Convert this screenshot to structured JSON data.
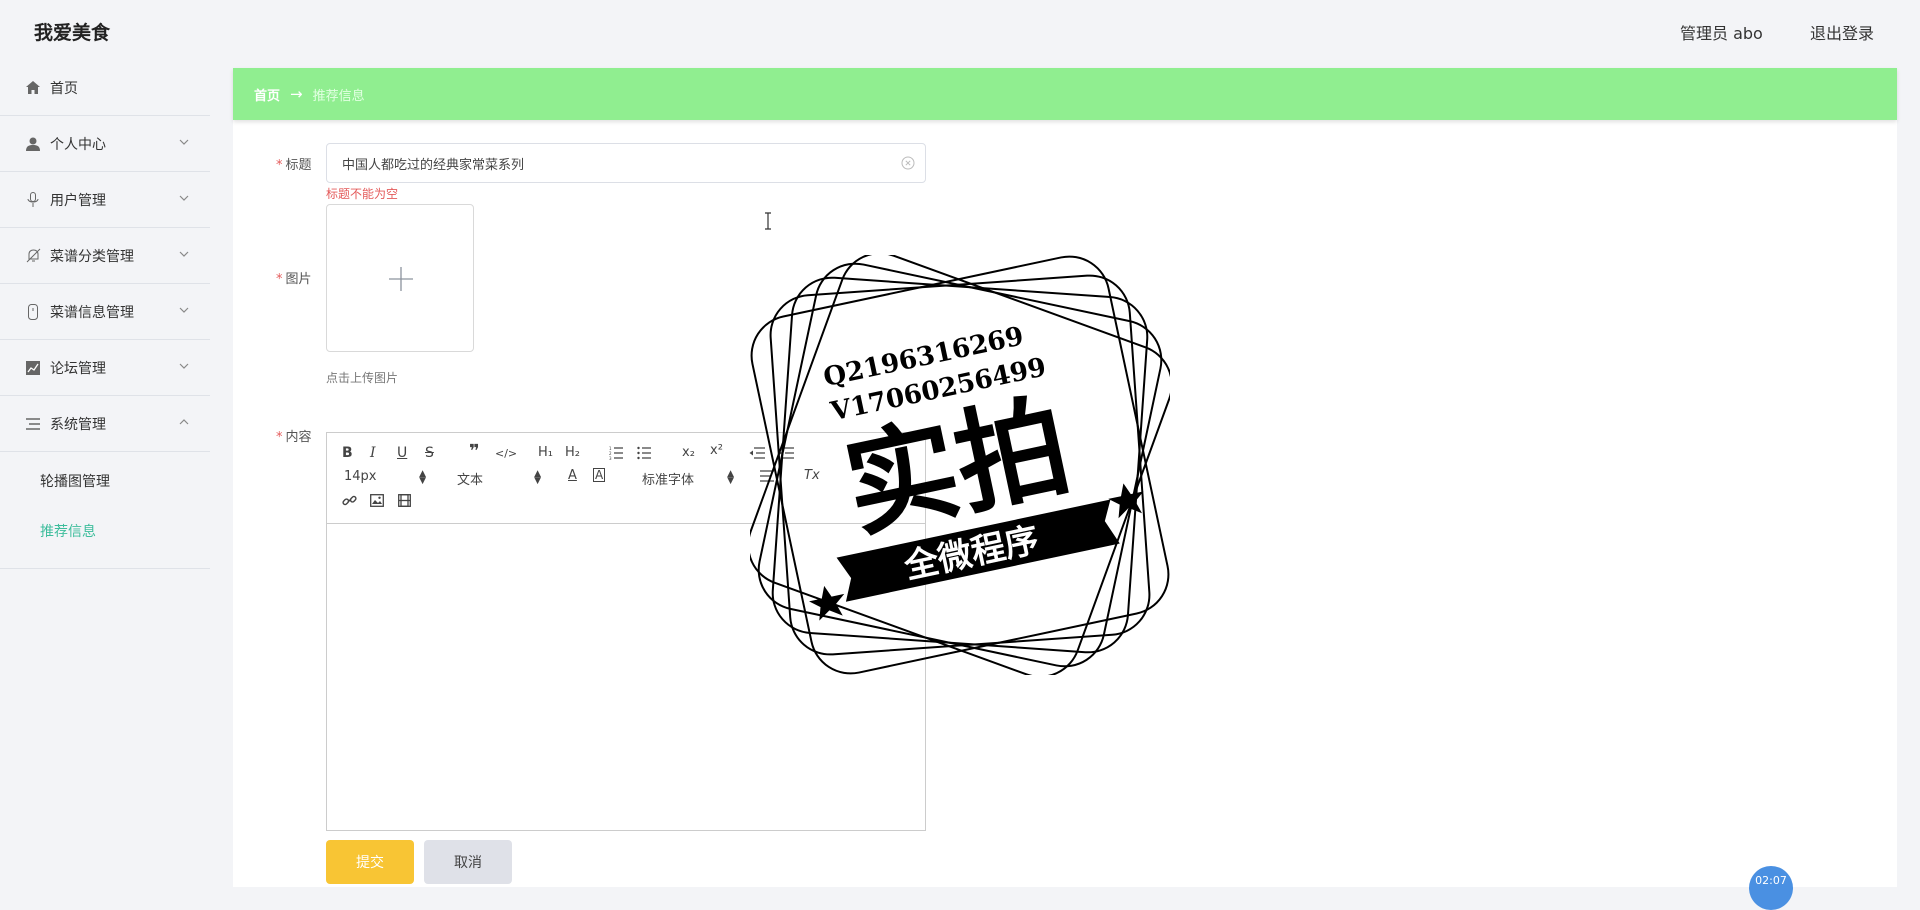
{
  "app": {
    "title": "我爱美食"
  },
  "header": {
    "admin_label": "管理员 abo",
    "logout_label": "退出登录"
  },
  "sidebar": {
    "items": [
      {
        "label": "首页",
        "icon": "home-icon",
        "expandable": false
      },
      {
        "label": "个人中心",
        "icon": "person-icon",
        "expandable": true
      },
      {
        "label": "用户管理",
        "icon": "microphone-icon",
        "expandable": true
      },
      {
        "label": "菜谱分类管理",
        "icon": "bell-off-icon",
        "expandable": true
      },
      {
        "label": "菜谱信息管理",
        "icon": "device-icon",
        "expandable": true
      },
      {
        "label": "论坛管理",
        "icon": "chart-icon",
        "expandable": true
      },
      {
        "label": "系统管理",
        "icon": "list-icon",
        "expandable": true,
        "expanded": true
      }
    ],
    "subitems": [
      {
        "label": "轮播图管理",
        "active": false
      },
      {
        "label": "推荐信息",
        "active": true
      }
    ]
  },
  "breadcrumb": {
    "home": "首页",
    "separator": "→",
    "current": "推荐信息"
  },
  "form": {
    "title_label": "标题",
    "title_value": "中国人都吃过的经典家常菜系列",
    "title_error": "标题不能为空",
    "image_label": "图片",
    "upload_hint": "点击上传图片",
    "content_label": "内容",
    "required_mark": "*"
  },
  "editor": {
    "font_size": "14px",
    "header_select": "文本",
    "font_family": "标准字体",
    "buttons": [
      "bold",
      "italic",
      "underline",
      "strike",
      "blockquote",
      "code-block",
      "header-1",
      "header-2",
      "ordered-list",
      "bullet-list",
      "subscript",
      "superscript",
      "indent-decrease",
      "indent-increase",
      "font-color",
      "background-color",
      "align",
      "clean",
      "link",
      "image",
      "video"
    ]
  },
  "actions": {
    "submit_label": "提交",
    "cancel_label": "取消"
  },
  "watermark": {
    "line1": "Q2196316269",
    "line2": "V17060256499",
    "main_text": "实拍",
    "banner_text": "全微程序"
  },
  "float_button": {
    "label": "02:07"
  },
  "colors": {
    "breadcrumb_bg": "#90ee90",
    "active_menu": "#3dbd9c",
    "submit_bg": "#f8c534",
    "cancel_bg": "#dfe1e8",
    "error": "#e45b5b"
  }
}
